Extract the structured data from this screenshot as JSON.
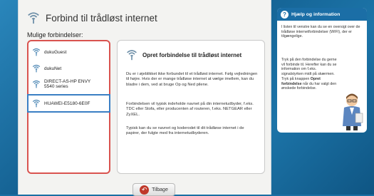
{
  "window": {
    "title": "Forbind til trådløst internet",
    "subtitle": "Mulige forbindelser:"
  },
  "networks": [
    {
      "name": "dukuGuest",
      "selected": false
    },
    {
      "name": "dukuNet",
      "selected": false
    },
    {
      "name": "DIRECT-AS-HP ENVY 5540 series",
      "selected": false
    },
    {
      "name": "HUAWEI-E5180-6E0F",
      "selected": true
    }
  ],
  "info": {
    "title": "Opret forbindelse til trådløst internet",
    "paragraph1": "Du er i øjeblikket ikke forbundet til et trådløst internet. Følg vejledningen til højre. Hvis der er mange trådløse internet at vælge imellem, kan du bladre i dem, ved at bruge Op og Ned pilene.",
    "paragraph2": "Forbindelsen vil typisk indeholde navnet på din internetudbyder, f.eks. TDC eller Stofa, eller producenten af routeren, f.eks. NETGEAR eller ZyXEL.",
    "paragraph3": "Typisk kan du se navnet og koderodet til dit trådløse internet i de papirer, der fulgte med fra internetudbyderen."
  },
  "help": {
    "title": "Hjælp og information",
    "paragraph1": "I listen til venstre kan du se en oversigt over de trådløse internetforbindelser (WIFI), der er tilgængelige.",
    "paragraph2a": "Tryk på den forbindelse du gerne vil forbinde til. Herefter kan du se information om f.eks. signalstyrken midt på skærmen. Tryk på knappen",
    "paragraph2b": "Opret forbindelse",
    "paragraph2c": "når du har valgt den ønskede forbindelse."
  },
  "buttons": {
    "back_label": "Tilbage"
  },
  "colors": {
    "accent_blue": "#1b6ea6",
    "list_border_red": "#d9534f",
    "selection_blue": "#3a7fc4",
    "back_icon_red": "#c0392b"
  },
  "icons": {
    "network": "wifi-icon",
    "help": "question-icon",
    "back": "back-arrow-icon"
  }
}
